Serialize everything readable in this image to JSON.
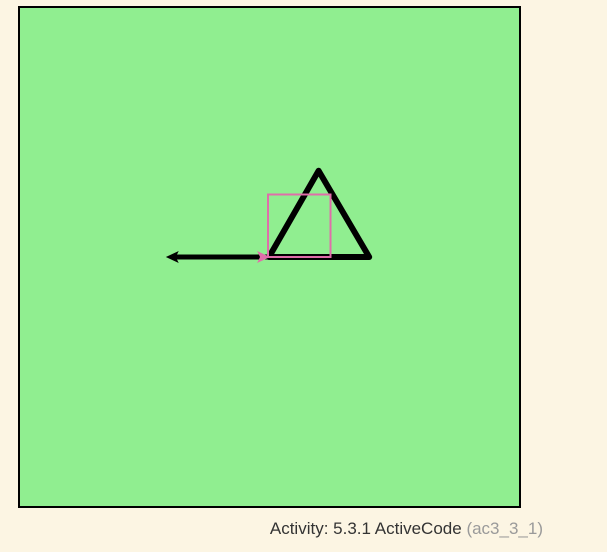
{
  "canvas": {
    "background": "#90ee90",
    "border_color": "#000000"
  },
  "drawing": {
    "shapes": [
      {
        "name": "triangle",
        "color": "#000000"
      },
      {
        "name": "line-arrow",
        "color": "#000000"
      },
      {
        "name": "square",
        "color": "#e06eaa"
      },
      {
        "name": "turtle-cursor",
        "color": "#e06eaa"
      }
    ]
  },
  "caption": {
    "label": "Activity: 5.3.1 ActiveCode",
    "id": "(ac3_3_1)"
  }
}
